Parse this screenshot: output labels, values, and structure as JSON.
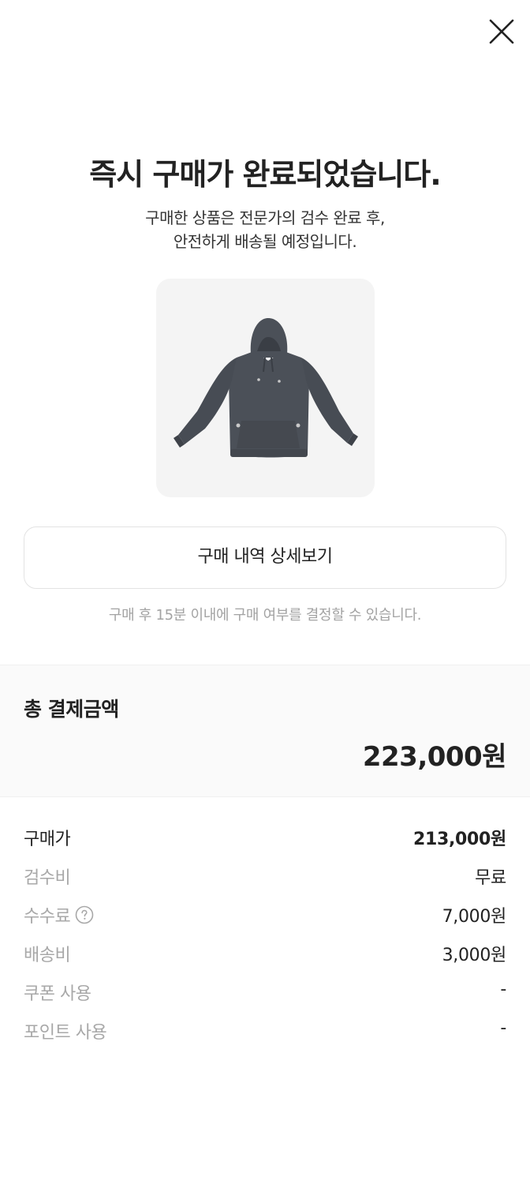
{
  "icons": {
    "close": "close-icon",
    "help": "question-circle-icon",
    "product": "hoodie-image"
  },
  "colors": {
    "text_primary": "#222222",
    "text_secondary": "#a8a8a8",
    "product_bg": "#f4f4f4",
    "summary_bg": "#fafafa",
    "hoodie": "#4b5058"
  },
  "header": {
    "title": "즉시 구매가 완료되었습니다.",
    "subtitle_line1": "구매한 상품은 전문가의 검수 완료 후,",
    "subtitle_line2": "안전하게 배송될 예정입니다."
  },
  "actions": {
    "detail_button": "구매 내역 상세보기",
    "note": "구매 후 15분 이내에 구매 여부를 결정할 수 있습니다."
  },
  "total": {
    "label": "총 결제금액",
    "amount": "223,000원"
  },
  "breakdown": [
    {
      "label": "구매가",
      "value": "213,000원"
    },
    {
      "label": "검수비",
      "value": "무료"
    },
    {
      "label": "수수료",
      "value": "7,000원"
    },
    {
      "label": "배송비",
      "value": "3,000원"
    },
    {
      "label": "쿠폰 사용",
      "value": "-"
    },
    {
      "label": "포인트 사용",
      "value": "-"
    }
  ]
}
